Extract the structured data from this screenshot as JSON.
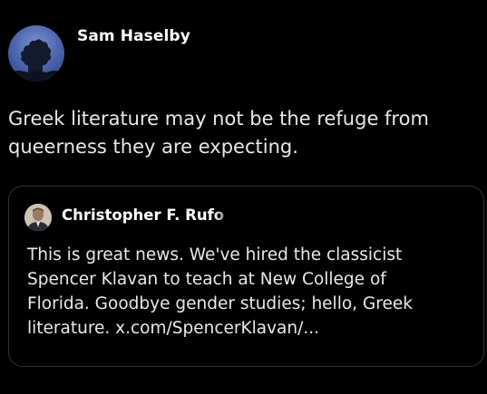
{
  "post": {
    "author": {
      "name": "Sam Haselby",
      "avatar_icon": "tree-silhouette-avatar"
    },
    "text_lines": [
      "Greek literature may not be the refuge from",
      "queerness they are expecting."
    ],
    "quoted_post": {
      "author": {
        "name": "Christopher F. Rufo",
        "avatar_icon": "person-portrait-avatar"
      },
      "text_lines": [
        "This is great news. We've hired the classicist",
        "Spencer Klavan to teach at New College of",
        "Florida. Goodbye gender studies; hello, Greek",
        "literature. x.com/SpencerKlavan/..."
      ]
    }
  },
  "colors": {
    "background": "#000000",
    "text": "#e7e9ea",
    "border": "#2f3336"
  }
}
